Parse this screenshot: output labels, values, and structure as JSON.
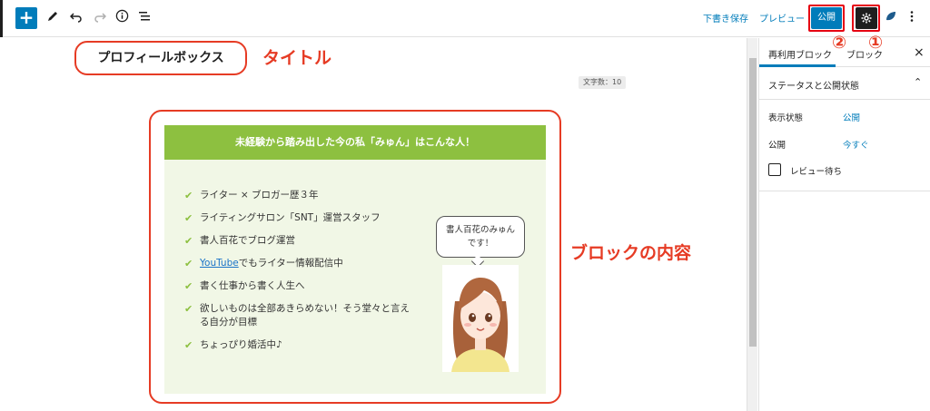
{
  "toolbar": {
    "add_icon": "plus-icon",
    "save_draft": "下書き保存",
    "preview": "プレビュー",
    "publish": "公開",
    "settings_icon": "gear-icon"
  },
  "annotations": {
    "title_label": "タイトル",
    "content_label": "ブロックの内容",
    "marker_1": "①",
    "marker_2": "②"
  },
  "editor": {
    "title": "プロフィールボックス",
    "word_count": "文字数：10"
  },
  "profile_box": {
    "heading": "未経験から踏み出した今の私「みゅん」はこんな人！",
    "items": [
      "ライター × ブロガー歴３年",
      "ライティングサロン「SNT」運営スタッフ",
      "書人百花でブログ運営",
      "YouTube",
      "書く仕事から書く人生へ",
      "欲しいものは全部あきらめない！そう堂々と言える自分が目標",
      "ちょっぴり婚活中♪"
    ],
    "item4_suffix": "でもライター情報配信中",
    "bubble_line1": "書人百花のみゅん",
    "bubble_line2": "です！"
  },
  "sidebar": {
    "tab_reusable": "再利用ブロック",
    "tab_block": "ブロック",
    "section_title": "ステータスと公開状態",
    "visibility_label": "表示状態",
    "visibility_value": "公開",
    "publish_label": "公開",
    "publish_value": "今すぐ",
    "pending_review": "レビュー待ち"
  },
  "colors": {
    "accent": "#007cba",
    "annotation_red": "#e63b24",
    "profile_green": "#8dc040",
    "profile_bg": "#f1f7e6"
  }
}
